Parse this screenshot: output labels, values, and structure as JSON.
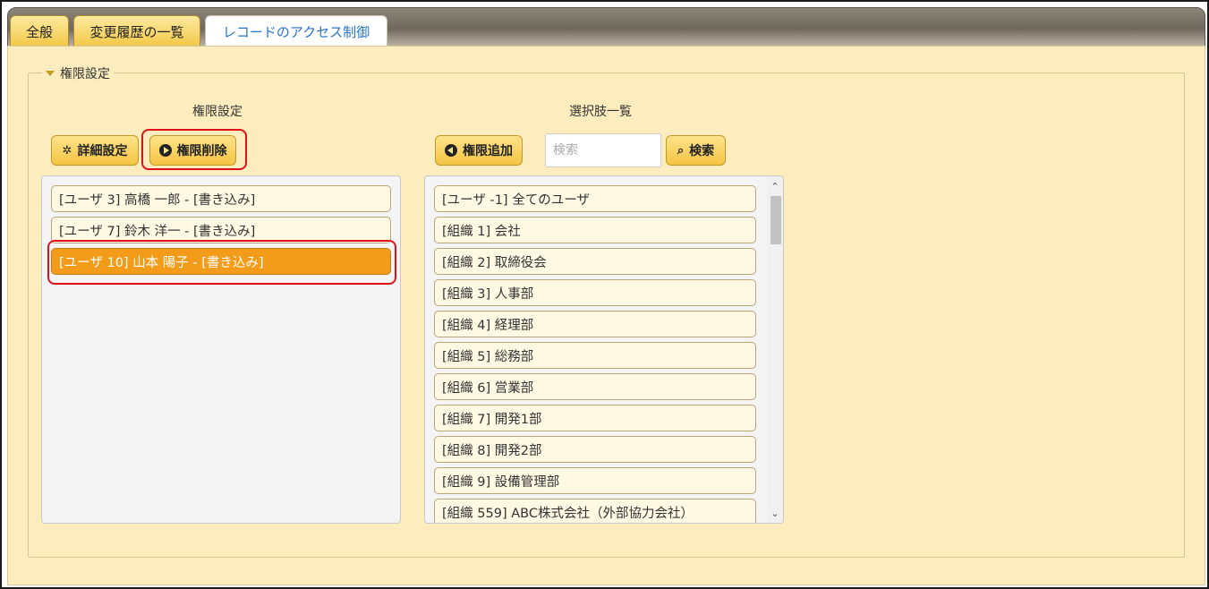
{
  "tabs": [
    {
      "label": "全般"
    },
    {
      "label": "変更履歴の一覧"
    },
    {
      "label": "レコードのアクセス制御"
    }
  ],
  "section": {
    "legend": "権限設定"
  },
  "left": {
    "title": "権限設定",
    "buttons": {
      "detail": "詳細設定",
      "remove": "権限削除"
    },
    "items": [
      {
        "label": "[ユーザ 3] 高橋 一郎 - [書き込み]"
      },
      {
        "label": "[ユーザ 7] 鈴木 洋一 - [書き込み]"
      },
      {
        "label": "[ユーザ 10] 山本 陽子 - [書き込み]"
      }
    ]
  },
  "right": {
    "title": "選択肢一覧",
    "buttons": {
      "add": "権限追加",
      "search": "検索"
    },
    "search": {
      "placeholder": "検索",
      "value": ""
    },
    "items": [
      {
        "label": "[ユーザ -1] 全てのユーザ"
      },
      {
        "label": "[組織 1] 会社"
      },
      {
        "label": "[組織 2] 取締役会"
      },
      {
        "label": "[組織 3] 人事部"
      },
      {
        "label": "[組織 4] 経理部"
      },
      {
        "label": "[組織 5] 総務部"
      },
      {
        "label": "[組織 6] 営業部"
      },
      {
        "label": "[組織 7] 開発1部"
      },
      {
        "label": "[組織 8] 開発2部"
      },
      {
        "label": "[組織 9] 設備管理部"
      },
      {
        "label": "[組織 559] ABC株式会社（外部協力会社）"
      }
    ]
  },
  "colors": {
    "accent": "#f29c1a",
    "tab_active_text": "#2a73c5",
    "panel_bg": "#fdecbd",
    "highlight": "#e0101a"
  },
  "icons": {
    "detail": "gear-icon",
    "remove": "arrow-right-circle-icon",
    "add": "arrow-left-circle-icon",
    "search": "search-icon"
  }
}
